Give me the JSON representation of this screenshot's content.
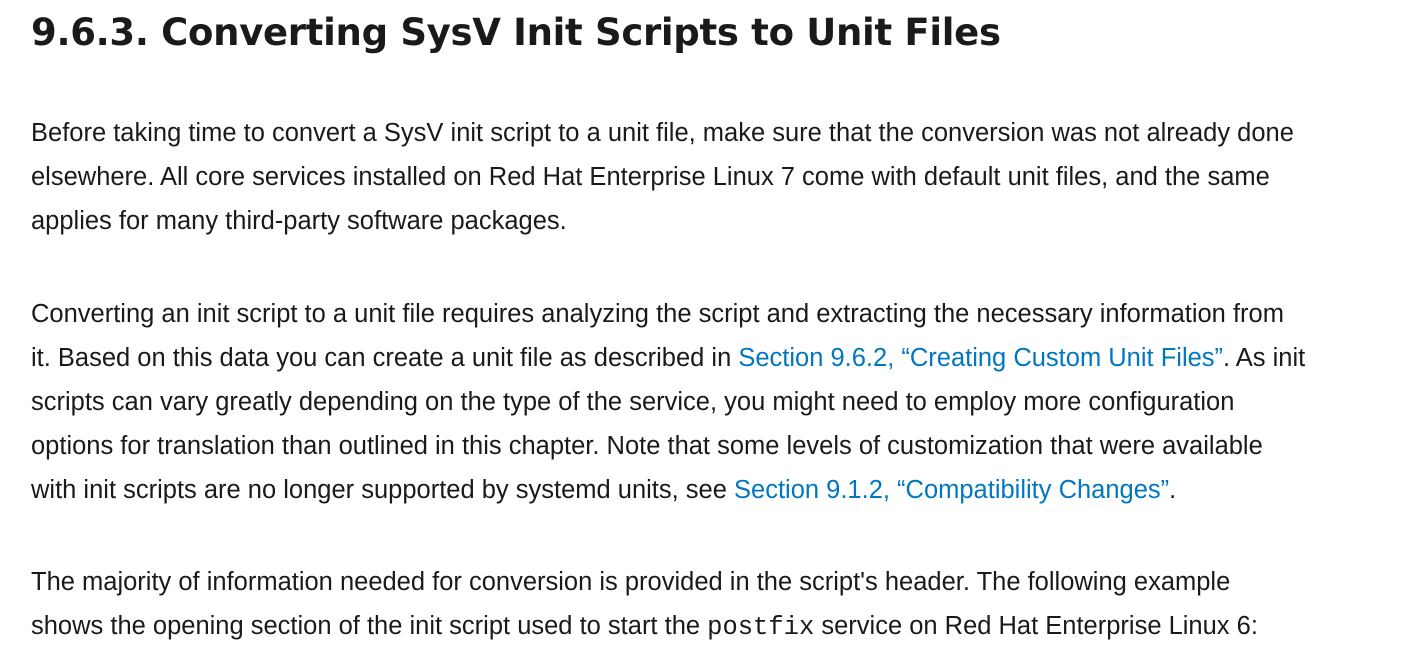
{
  "section": {
    "title": "9.6.3. Converting SysV Init Scripts to Unit Files"
  },
  "paragraph1": {
    "line1": "Before taking time to convert a SysV init script to a unit file, make sure that the conversion was not already done",
    "line2": "elsewhere. All core services installed on Red Hat Enterprise Linux 7 come with default unit files, and the same",
    "line3": "applies for many third-party software packages."
  },
  "paragraph2": {
    "line1": "Converting an init script to a unit file requires analyzing the script and extracting the necessary information from",
    "line2_before": "it. Based on this data you can create a unit file as described in ",
    "link1": "Section 9.6.2, “Creating Custom Unit Files”",
    "line2_after": ". As init",
    "line3": "scripts can vary greatly depending on the type of the service, you might need to employ more configuration",
    "line4": "options for translation than outlined in this chapter. Note that some levels of customization that were available",
    "line5_before": "with init scripts are no longer supported by systemd units, see ",
    "link2": "Section 9.1.2, “Compatibility Changes”",
    "line5_after": "."
  },
  "paragraph3": {
    "line1": "The majority of information needed for conversion is provided in the script's header. The following example",
    "line2_before": "shows the opening section of the init script used to start the ",
    "code": "postfix",
    "line2_after": " service on Red Hat Enterprise Linux 6:"
  },
  "colors": {
    "text": "#1a1a1a",
    "link": "#0077c0",
    "background": "#ffffff"
  }
}
